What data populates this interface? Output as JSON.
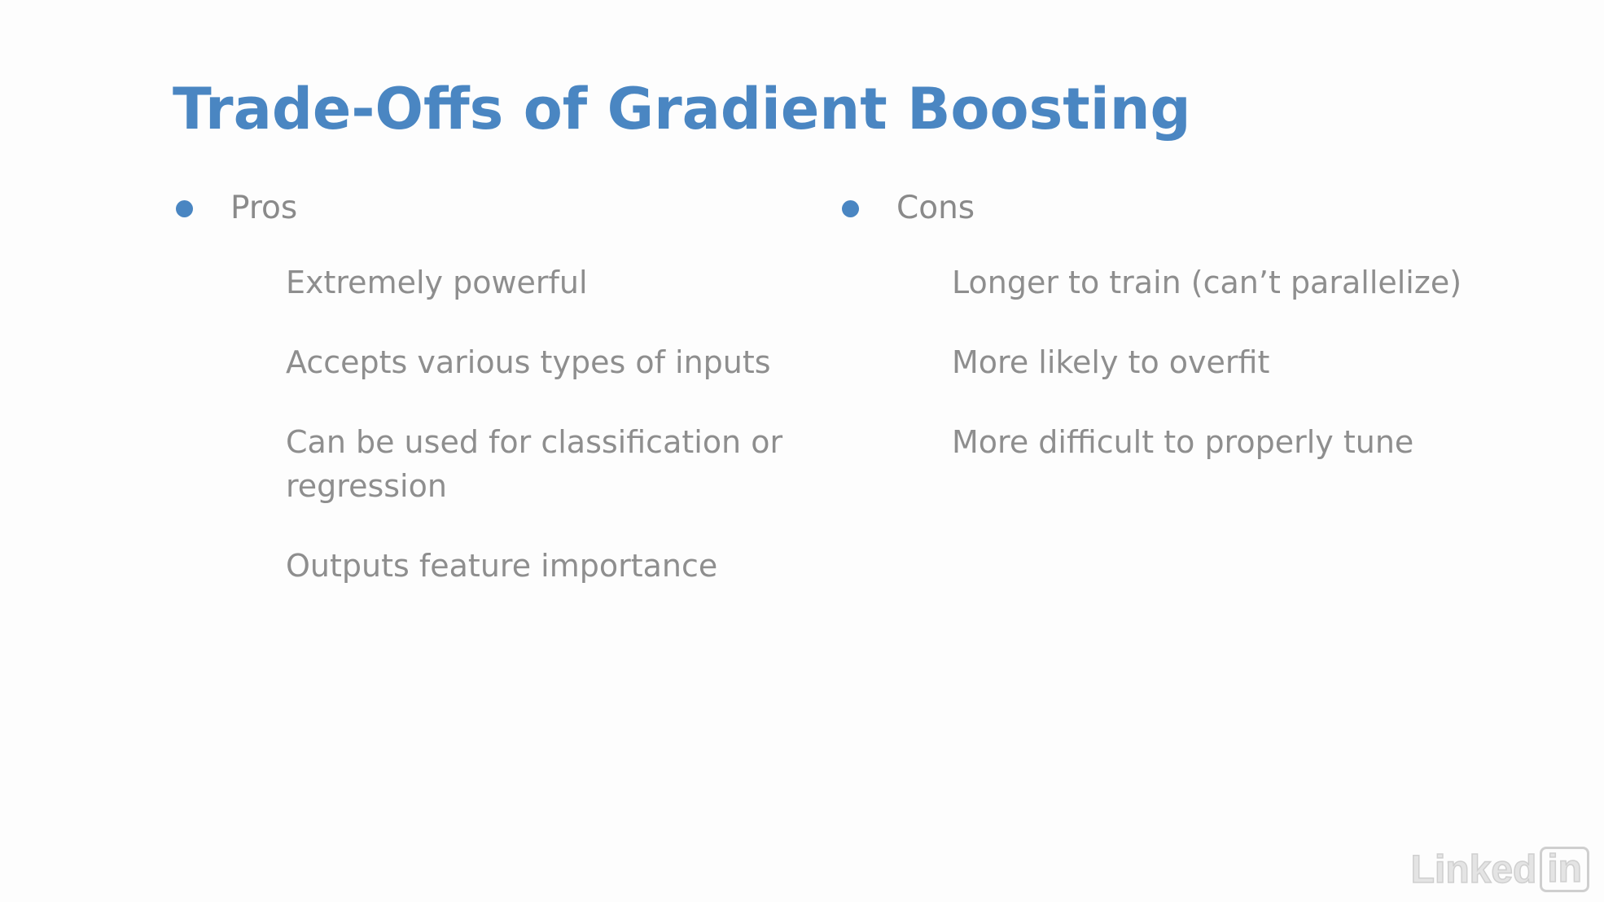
{
  "slide": {
    "title": "Trade-Offs of Gradient Boosting",
    "accent_color": "#4a86c2",
    "text_color": "#8e8e8e",
    "pros": {
      "label": "Pros",
      "items": [
        "Extremely powerful",
        "Accepts various types of inputs",
        "Can be used for classification or regression",
        "Outputs feature importance"
      ]
    },
    "cons": {
      "label": "Cons",
      "items": [
        "Longer to train (can’t parallelize)",
        "More likely to overfit",
        "More difficult to properly tune"
      ]
    }
  },
  "watermark": {
    "brand_text": "Linked",
    "brand_box_text": "in",
    "icon": "linkedin-logo-icon"
  }
}
